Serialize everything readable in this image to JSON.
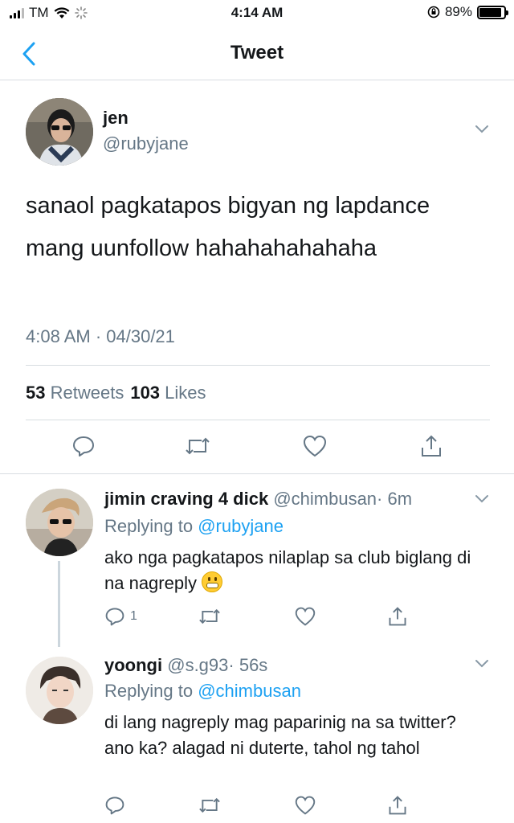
{
  "status_bar": {
    "carrier": "TM",
    "time": "4:14 AM",
    "battery": "89%",
    "battery_level": 0.89
  },
  "nav": {
    "title": "Tweet",
    "back_icon": "chevron-left-icon"
  },
  "main_tweet": {
    "name": "jen",
    "handle": "@rubyjane",
    "text": "sanaol pagkatapos bigyan ng lapdance mang uunfollow hahahahahahaha",
    "timestamp": "4:08 AM · 04/30/21",
    "retweets_count": "53",
    "retweets_label": "Retweets",
    "likes_count": "103",
    "likes_label": "Likes"
  },
  "replies": [
    {
      "name": "jimin craving 4 dick",
      "handle": "@chimbusan",
      "time": "· 6m",
      "replying_prefix": "Replying to",
      "replying_to": "@rubyjane",
      "text": "ako nga pagkatapos nilaplap sa club biglang di na nagreply",
      "reply_count": "1"
    },
    {
      "name": "yoongi",
      "handle": "@s.g93",
      "time": "· 56s",
      "replying_prefix": "Replying to",
      "replying_to": "@chimbusan",
      "text": "di lang nagreply mag paparinig na sa twitter? ano ka? alagad ni duterte, tahol ng tahol",
      "reply_count": ""
    }
  ],
  "colors": {
    "accent": "#1da1f2",
    "muted": "#657786",
    "divider": "#d8dde1",
    "text": "#14171a"
  }
}
